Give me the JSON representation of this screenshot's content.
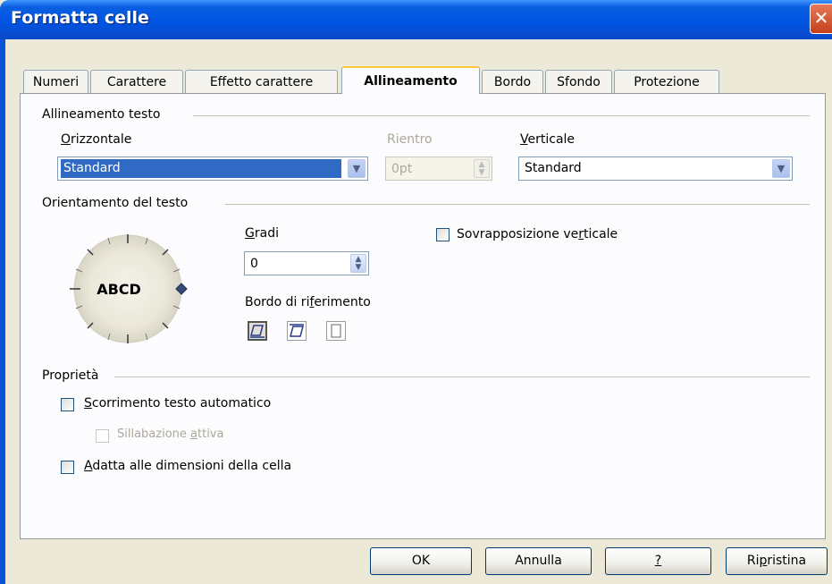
{
  "window": {
    "title": "Formatta celle"
  },
  "tabs": [
    "Numeri",
    "Carattere",
    "Effetto carattere",
    "Allineamento",
    "Bordo",
    "Sfondo",
    "Protezione"
  ],
  "alignment": {
    "section_label": "Allineamento testo",
    "horizontal": {
      "label_hot": "O",
      "label_rest": "rizzontale",
      "value": "Standard"
    },
    "indent": {
      "label": "Rientro",
      "value": "0pt"
    },
    "vertical": {
      "label_hot": "V",
      "label_rest": "erticale",
      "value": "Standard"
    }
  },
  "orientation": {
    "section_label": "Orientamento del testo",
    "dial_text": "ABCD",
    "degrees": {
      "label_hot": "G",
      "label_rest": "radi",
      "value": "0"
    },
    "vertical_stacking": {
      "label_pre": "Sovrapposizione ve",
      "label_hot": "r",
      "label_post": "ticale",
      "checked": false
    },
    "reference_edge": {
      "label_pre": "Bordo di ri",
      "label_hot": "f",
      "label_post": "erimento"
    }
  },
  "properties": {
    "section_label": "Proprietà",
    "wrap_text": {
      "label_hot": "S",
      "label_rest": "corrimento testo automatico",
      "checked": false
    },
    "hyphenation": {
      "label_pre": "Sillabazione ",
      "label_hot": "a",
      "label_post": "ttiva",
      "checked": false
    },
    "shrink_to_fit": {
      "label_hot": "A",
      "label_rest": "datta alle dimensioni della cella",
      "checked": false
    }
  },
  "buttons": {
    "ok": "OK",
    "cancel": "Annulla",
    "help": "?",
    "reset_pre": "Ri",
    "reset_hot": "p",
    "reset_post": "ristina"
  },
  "colors": {
    "titlebar": "#0054e3",
    "selection": "#316ac5",
    "active_tab_accent": "#ffc83c",
    "dialog_bg": "#ece9d8"
  },
  "icons": [
    "close-icon",
    "dropdown-arrow-icon",
    "spin-arrows-icon",
    "rotation-dial-icon",
    "edge-bottom-icon",
    "edge-top-icon",
    "edge-inside-icon"
  ]
}
